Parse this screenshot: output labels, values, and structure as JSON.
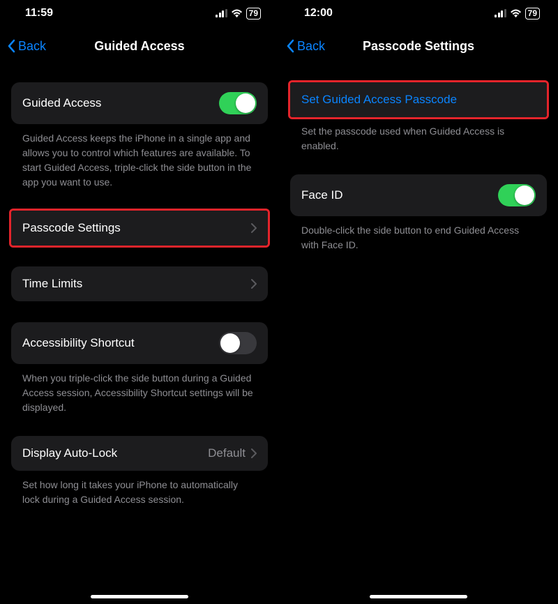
{
  "left": {
    "status": {
      "time": "11:59",
      "battery": "79"
    },
    "nav": {
      "back": "Back",
      "title": "Guided Access"
    },
    "guidedAccess": {
      "label": "Guided Access",
      "footer": "Guided Access keeps the iPhone in a single app and allows you to control which features are available. To start Guided Access, triple-click the side button in the app you want to use."
    },
    "passcode": {
      "label": "Passcode Settings"
    },
    "timeLimits": {
      "label": "Time Limits"
    },
    "shortcut": {
      "label": "Accessibility Shortcut",
      "footer": "When you triple-click the side button during a Guided Access session, Accessibility Shortcut settings will be displayed."
    },
    "autoLock": {
      "label": "Display Auto-Lock",
      "value": "Default",
      "footer": "Set how long it takes your iPhone to automatically lock during a Guided Access session."
    }
  },
  "right": {
    "status": {
      "time": "12:00",
      "battery": "79"
    },
    "nav": {
      "back": "Back",
      "title": "Passcode Settings"
    },
    "setPasscode": {
      "label": "Set Guided Access Passcode",
      "footer": "Set the passcode used when Guided Access is enabled."
    },
    "faceId": {
      "label": "Face ID",
      "footer": "Double-click the side button to end Guided Access with Face ID."
    }
  }
}
